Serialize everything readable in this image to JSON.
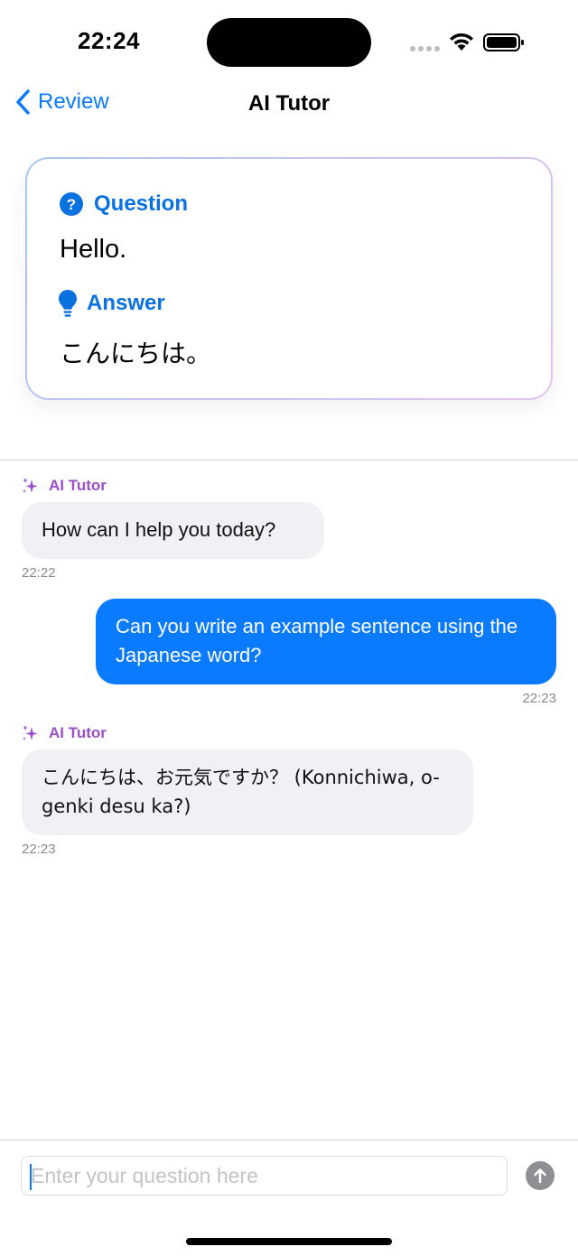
{
  "status_bar": {
    "time": "22:24"
  },
  "nav": {
    "back_label": "Review",
    "title": "AI Tutor"
  },
  "card": {
    "question_label": "Question",
    "question_text": "Hello.",
    "answer_label": "Answer",
    "answer_text": "こんにちは。"
  },
  "chat": {
    "messages": [
      {
        "role": "ai",
        "sender": "AI Tutor",
        "text": "How can I help you today?",
        "time": "22:22"
      },
      {
        "role": "user",
        "text": "Can you write an example sentence using the Japanese word?",
        "time": "22:23"
      },
      {
        "role": "ai",
        "sender": "AI Tutor",
        "text": "こんにちは、お元気ですか？ (Konnichiwa, o-genki desu ka?)",
        "time": "22:23"
      }
    ]
  },
  "input": {
    "placeholder": "Enter your question here"
  },
  "colors": {
    "accent": "#0a7aff",
    "ai_label": "#9a4fc8",
    "ai_bubble": "#f0f0f5",
    "user_bubble": "#0a7aff"
  }
}
